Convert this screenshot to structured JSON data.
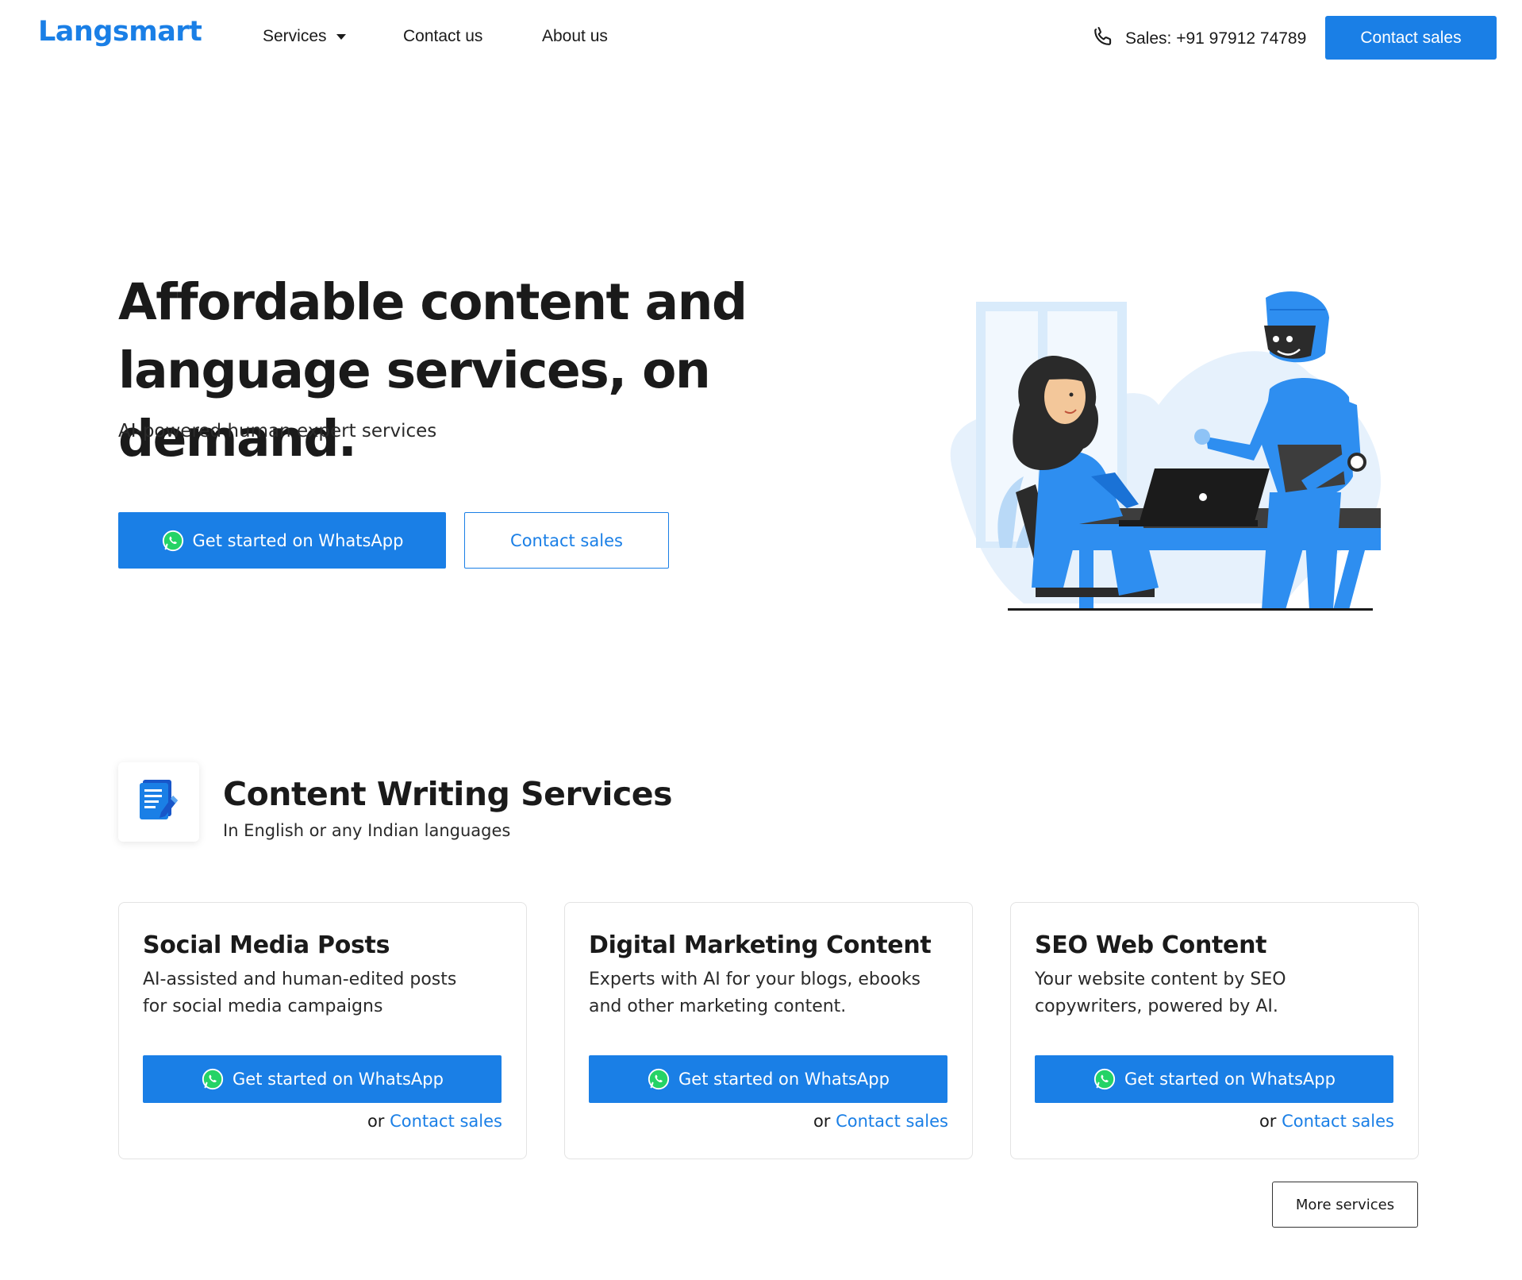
{
  "header": {
    "logo": "Langsmart",
    "nav": {
      "services": "Services",
      "contact": "Contact us",
      "about": "About us"
    },
    "sales_phone": "Sales: +91 97912 74789",
    "contact_sales": "Contact sales"
  },
  "hero": {
    "title_line1": "Affordable content and",
    "title_line2": "language services, on demand.",
    "subtitle": "AI-powered human expert services",
    "whatsapp_button": "Get started on WhatsApp",
    "contact_button": "Contact sales"
  },
  "section": {
    "title": "Content Writing Services",
    "subtitle": "In English or any Indian languages",
    "cards": [
      {
        "title": "Social Media Posts",
        "desc_line1": "AI-assisted and human-edited posts",
        "desc_line2": "for social media campaigns",
        "button": "Get started on WhatsApp",
        "or": "or",
        "link": "Contact sales"
      },
      {
        "title": "Digital Marketing Content",
        "desc_line1": "Experts with AI for your blogs, ebooks",
        "desc_line2": "and other marketing content.",
        "button": "Get started on WhatsApp",
        "or": "or",
        "link": "Contact sales"
      },
      {
        "title": "SEO Web Content",
        "desc_line1": "Your website content by SEO",
        "desc_line2": "copywriters, powered by AI.",
        "button": "Get started on WhatsApp",
        "or": "or",
        "link": "Contact sales"
      }
    ],
    "more_button": "More services"
  },
  "colors": {
    "accent": "#1a7fe6",
    "text": "#1a1a1a",
    "whatsapp_green": "#25d366"
  },
  "icons": {
    "phone": "phone-icon",
    "whatsapp": "whatsapp-icon",
    "document": "document-edit-icon",
    "caret": "chevron-down-icon"
  }
}
